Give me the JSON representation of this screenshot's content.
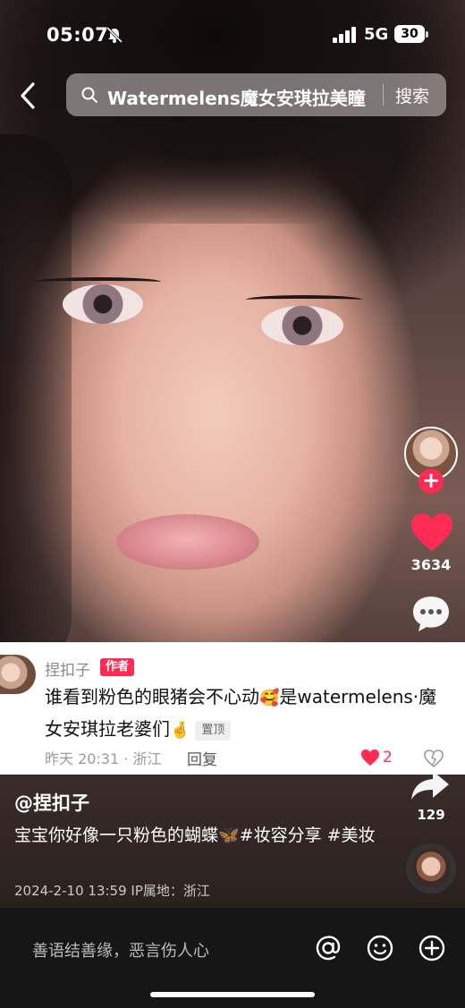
{
  "status_bar": {
    "time": "05:07",
    "network": "5G",
    "battery": "30",
    "icons": [
      "bell-slash-icon",
      "signal-icon"
    ]
  },
  "search": {
    "query": "Watermelens魔女安琪拉美瞳",
    "button_label": "搜索",
    "icons": [
      "back-arrow-icon",
      "search-icon"
    ]
  },
  "rail": {
    "like_count": "3634",
    "share_count": "129",
    "follow_label": "+",
    "icons": [
      "avatar",
      "heart-icon",
      "comment-icon",
      "share-icon",
      "music-disc"
    ],
    "colors": {
      "like": "#fe2c55",
      "follow": "#fe2c55"
    }
  },
  "pinned_comment": {
    "author": "捏扣子",
    "badge": "作者",
    "text_part1": "谁看到粉色的眼猪会不心动",
    "emoji1": "🥰",
    "text_part2": "是watermelens·魔女安琪拉老婆们",
    "emoji2": "🤞",
    "pinned_label": "置顶",
    "meta": "昨天 20:31 · 浙江",
    "reply_label": "回复",
    "like_count": "2"
  },
  "caption": {
    "author": "@捏扣子",
    "text": "宝宝你好像一只粉色的蝴蝶🦋#妆容分享 #美妆",
    "meta": "2024-2-10 13:59   IP属地：浙江"
  },
  "bottom_bar": {
    "placeholder": "善语结善缘，恶言伤人心",
    "icons": [
      "at-icon",
      "emoji-icon",
      "plus-icon"
    ]
  }
}
